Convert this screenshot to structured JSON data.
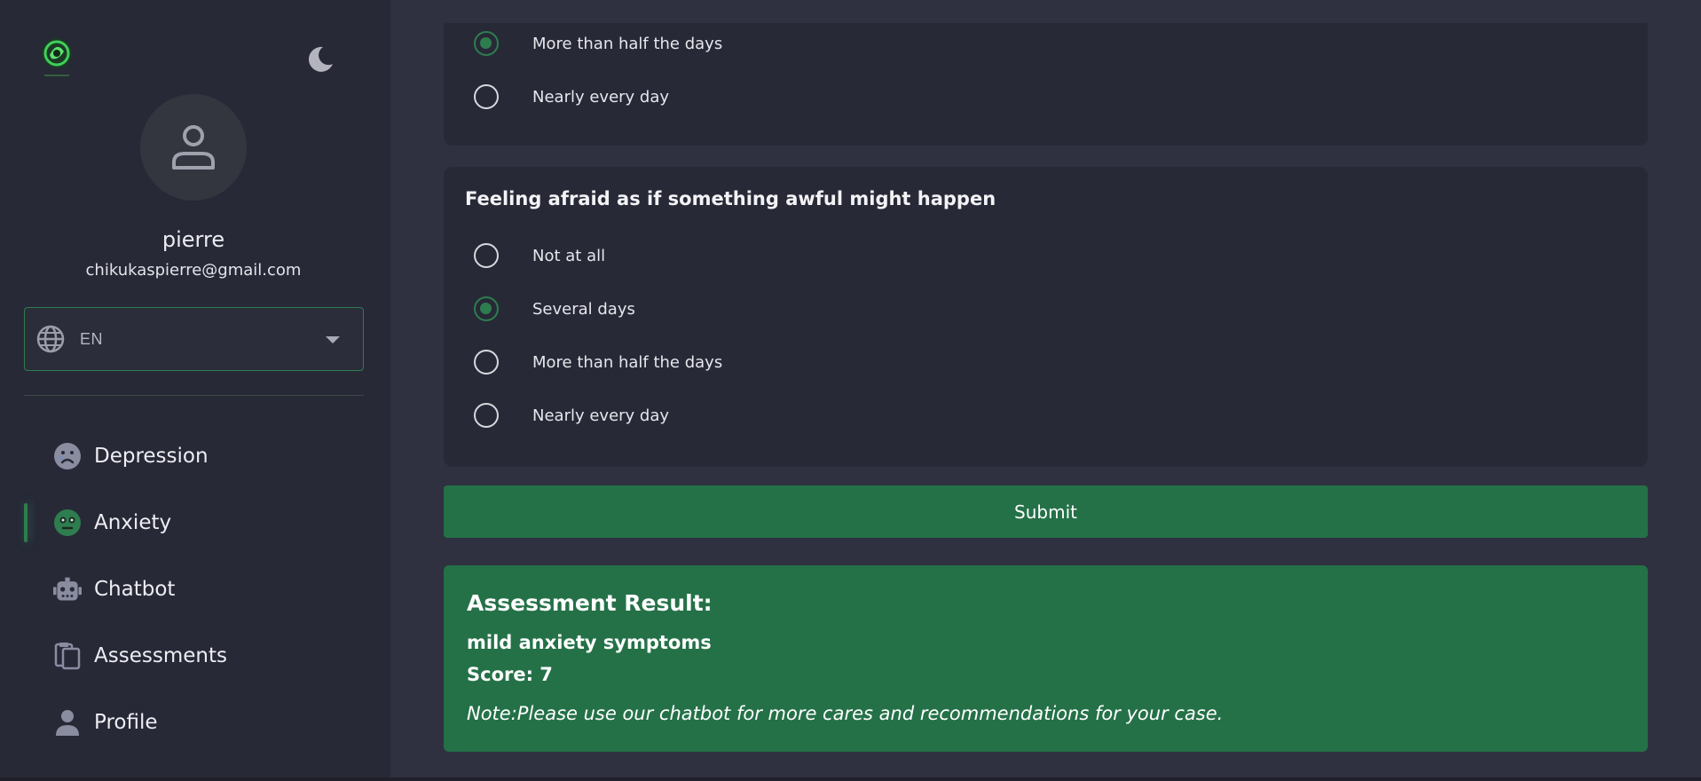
{
  "sidebar": {
    "user": {
      "name": "pierre",
      "email": "chikukaspierre@gmail.com"
    },
    "language": {
      "value": "EN",
      "icon": "globe-icon"
    },
    "theme_toggle_icon": "moon-icon",
    "nav": [
      {
        "label": "Depression",
        "icon": "sad-face-icon",
        "active": false
      },
      {
        "label": "Anxiety",
        "icon": "anxious-face-icon",
        "active": true
      },
      {
        "label": "Chatbot",
        "icon": "robot-icon",
        "active": false
      },
      {
        "label": "Assessments",
        "icon": "clipboard-icon",
        "active": false
      },
      {
        "label": "Profile",
        "icon": "person-icon",
        "active": false
      }
    ]
  },
  "previous_question": {
    "options": [
      {
        "label": "More than half the days",
        "checked": true
      },
      {
        "label": "Nearly every day",
        "checked": false
      }
    ]
  },
  "question": {
    "title": "Feeling afraid as if something awful might happen",
    "options": [
      {
        "label": "Not at all",
        "checked": false
      },
      {
        "label": "Several days",
        "checked": true
      },
      {
        "label": "More than half the days",
        "checked": false
      },
      {
        "label": "Nearly every day",
        "checked": false
      }
    ]
  },
  "submit_label": "Submit",
  "result": {
    "heading": "Assessment Result:",
    "level": "mild anxiety symptoms",
    "score": "Score: 7",
    "note": "Note:Please use our chatbot for more cares and recommendations for your case."
  },
  "colors": {
    "accent": "#247148",
    "sidebar_bg": "#272937",
    "main_bg": "#2f3140"
  }
}
